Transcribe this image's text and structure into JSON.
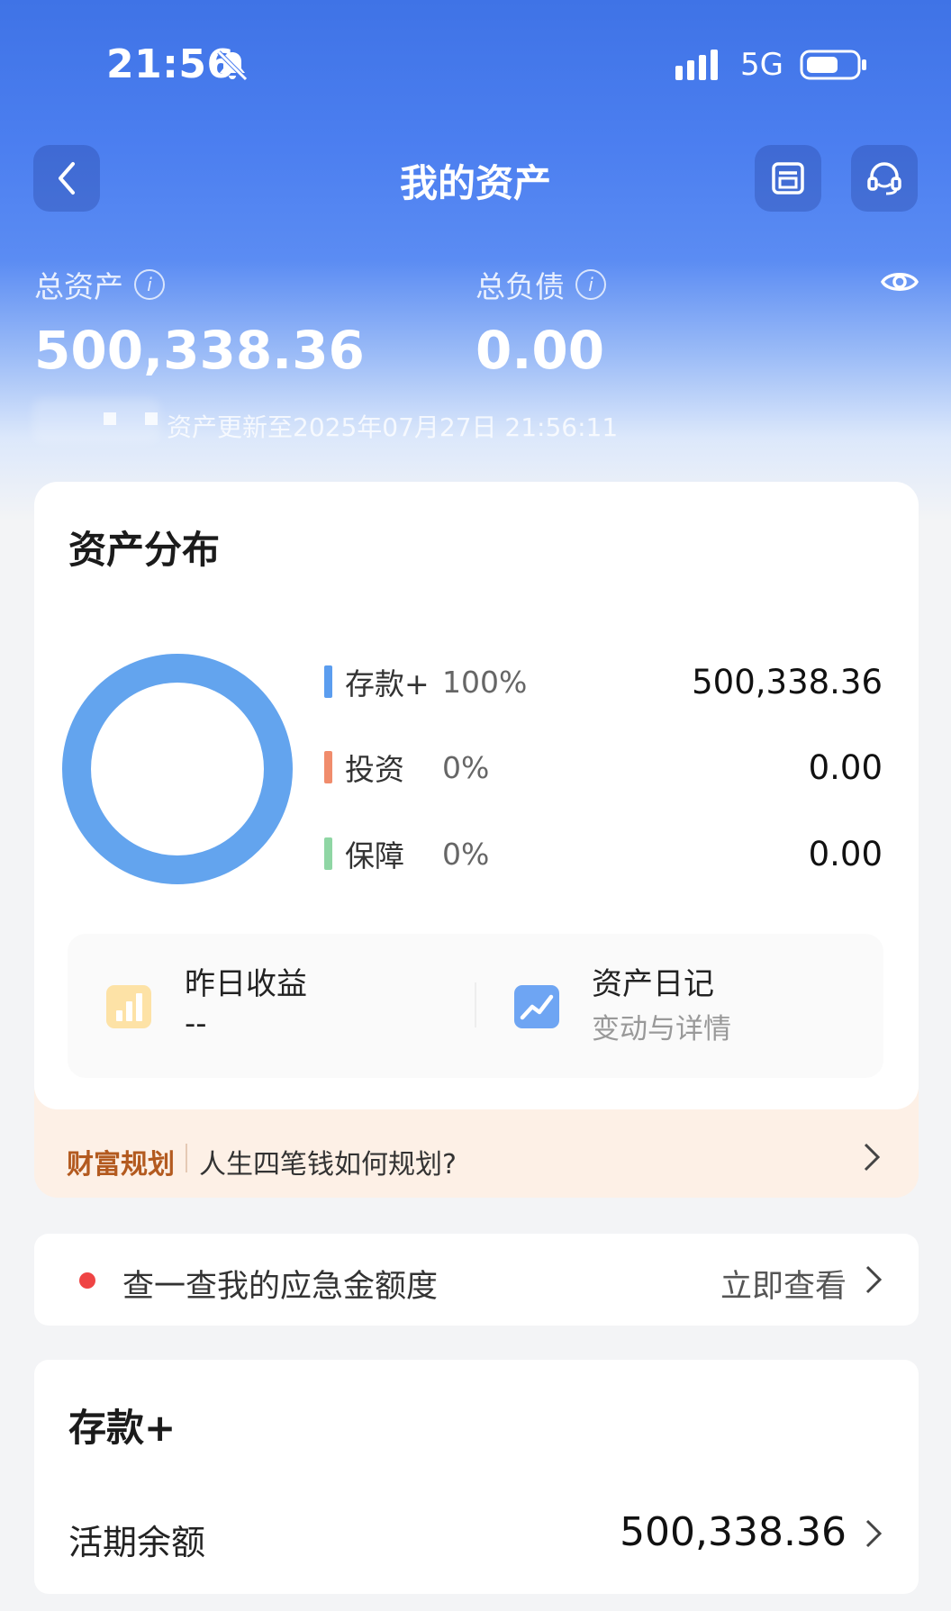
{
  "status_bar": {
    "time": "21:56",
    "network": "5G"
  },
  "header": {
    "title": "我的资产"
  },
  "summary": {
    "total_assets_label": "总资产",
    "total_assets_value": "500,338.36",
    "total_liabilities_label": "总负债",
    "total_liabilities_value": "0.00",
    "updated_text": "资产更新至2025年07月27日 21:56:11"
  },
  "distribution": {
    "title": "资产分布",
    "items": [
      {
        "name": "存款+",
        "percent": "100%",
        "value": "500,338.36",
        "color": "#5b9def"
      },
      {
        "name": "投资",
        "percent": "0%",
        "value": "0.00",
        "color": "#f08c6c"
      },
      {
        "name": "保障",
        "percent": "0%",
        "value": "0.00",
        "color": "#8fd6a4"
      }
    ]
  },
  "shortcuts": {
    "yesterday_label": "昨日收益",
    "yesterday_value": "--",
    "diary_label": "资产日记",
    "diary_sub": "变动与详情"
  },
  "wealth_plan": {
    "tag": "财富规划",
    "text": "人生四笔钱如何规划?"
  },
  "emergency": {
    "text": "查一查我的应急金额度",
    "action": "立即查看"
  },
  "deposit": {
    "title": "存款+",
    "balance_label": "活期余额",
    "balance_value": "500,338.36"
  }
}
